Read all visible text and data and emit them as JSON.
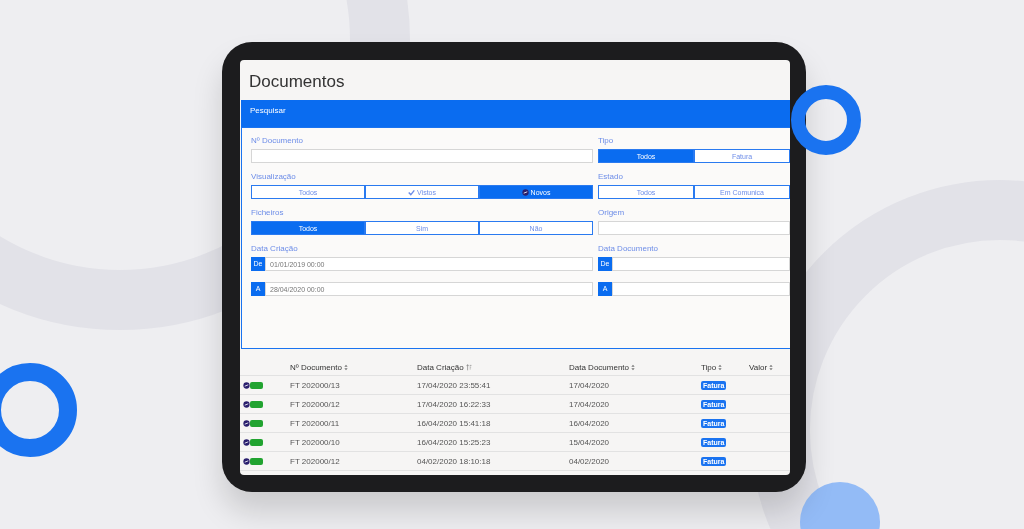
{
  "page_title": "Documentos",
  "search_panel": {
    "title": "Pesquisar",
    "left_fields": [
      {
        "kind": "text",
        "label": "Nº Documento"
      },
      {
        "kind": "segmented",
        "label": "Visualização",
        "options": [
          {
            "label": "Todos",
            "selected": false
          },
          {
            "label": "Vistos",
            "kind": "check",
            "selected": false
          },
          {
            "label": "Novos",
            "kind": "dot",
            "selected": true
          }
        ]
      },
      {
        "kind": "segmented",
        "label": "Ficheiros",
        "options": [
          {
            "label": "Todos",
            "selected": true
          },
          {
            "label": "Sim",
            "selected": false
          },
          {
            "label": "Não",
            "selected": false
          }
        ]
      },
      {
        "kind": "date_range",
        "label": "Data Criação",
        "rows": [
          {
            "prefix": "De",
            "value": "01/01/2019 00:00"
          },
          {
            "prefix": "A",
            "value": "28/04/2020 00:00"
          }
        ]
      }
    ],
    "right_fields": [
      {
        "kind": "segmented",
        "label": "Tipo",
        "options": [
          {
            "label": "Todos",
            "selected": true
          },
          {
            "label": "Fatura",
            "selected": false
          }
        ]
      },
      {
        "kind": "segmented",
        "label": "Estado",
        "options": [
          {
            "label": "Todos",
            "selected": false
          },
          {
            "label": "Em Comunica",
            "selected": false
          }
        ]
      },
      {
        "kind": "text",
        "label": "Origem"
      },
      {
        "kind": "date_range",
        "label": "Data Documento",
        "rows": [
          {
            "prefix": "De"
          },
          {
            "prefix": "A"
          }
        ]
      }
    ]
  },
  "table": {
    "columns": [
      {
        "label": "Nº Documento",
        "sorted": false
      },
      {
        "label": "Data Criação",
        "sorted": true
      },
      {
        "label": "Data Documento",
        "sorted": false
      },
      {
        "label": "Tipo",
        "sorted": false
      },
      {
        "label": "Valor",
        "sorted": false
      }
    ],
    "rows": [
      {
        "document": "FT 202000/13",
        "created": "17/04/2020 23:55:41",
        "doc_date": "17/04/2020",
        "type": "Fatura"
      },
      {
        "document": "FT 202000/12",
        "created": "17/04/2020 16:22:33",
        "doc_date": "17/04/2020",
        "type": "Fatura"
      },
      {
        "document": "FT 202000/11",
        "created": "16/04/2020 15:41:18",
        "doc_date": "16/04/2020",
        "type": "Fatura"
      },
      {
        "document": "FT 202000/10",
        "created": "16/04/2020 15:25:23",
        "doc_date": "15/04/2020",
        "type": "Fatura"
      },
      {
        "document": "FT 202000/12",
        "created": "04/02/2020 18:10:18",
        "doc_date": "04/02/2020",
        "type": "Fatura"
      }
    ]
  }
}
